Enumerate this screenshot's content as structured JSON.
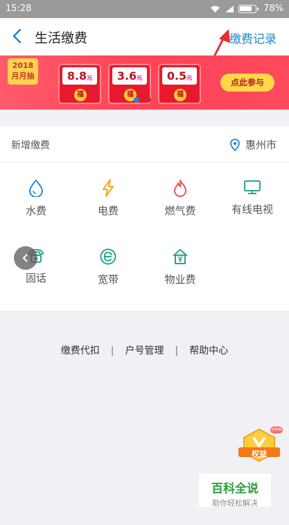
{
  "status": {
    "time": "15:28",
    "battery": "78%"
  },
  "nav": {
    "title": "生活缴费",
    "records": "缴费记录"
  },
  "banner": {
    "year": "2018",
    "tag": "月月抽",
    "packs": [
      {
        "amount": "8.8",
        "unit": "元",
        "fu": "福"
      },
      {
        "amount": "3.6",
        "unit": "元",
        "fu": "福"
      },
      {
        "amount": "0.5",
        "unit": "元",
        "fu": "福"
      }
    ],
    "join": "点此参与"
  },
  "section": {
    "label": "新增缴费",
    "city": "惠州市",
    "items": [
      {
        "label": "水费",
        "icon": "water-drop-icon"
      },
      {
        "label": "电费",
        "icon": "lightning-icon"
      },
      {
        "label": "燃气费",
        "icon": "flame-icon"
      },
      {
        "label": "有线电视",
        "icon": "tv-icon"
      },
      {
        "label": "固话",
        "icon": "telephone-icon"
      },
      {
        "label": "宽带",
        "icon": "broadband-icon"
      },
      {
        "label": "物业费",
        "icon": "house-yen-icon"
      }
    ]
  },
  "links": [
    "缴费代扣",
    "户号管理",
    "帮助中心"
  ],
  "badge": {
    "text": "权益",
    "new": "new"
  },
  "watermark": {
    "big": "百科全说",
    "small": "助你轻松解决"
  },
  "colors": {
    "accent": "#1e88d2",
    "banner": "#ff4357",
    "water": "#2d8ad6",
    "electric": "#f5a623",
    "gas": "#e8554e",
    "tv": "#2aa58c"
  }
}
